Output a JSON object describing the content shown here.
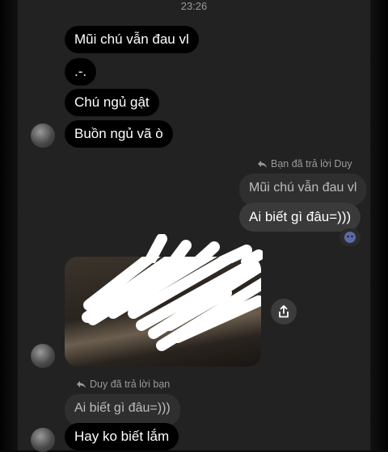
{
  "header": {
    "time": "23:26"
  },
  "messages": {
    "m1": "Mũi chú vẫn đau vl",
    "m2": ".-.",
    "m3": "Chú ngủ gật",
    "m4": "Buồn ngủ vã ò",
    "reply_note_1": "Bạn đã trả lời Duy",
    "quoted_1": "Mũi chú vẫn đau vl",
    "out_1": "Ai biết gì đâu=)))",
    "reply_note_2": "Duy đã trả lời bạn",
    "quoted_2": "Ai biết gì đâu=)))",
    "m5": "Hay ko biết lắm"
  },
  "icons": {
    "reply": "reply-arrow-icon",
    "share": "share-icon",
    "reaction": "emoji-reaction-icon"
  },
  "colors": {
    "background": "#222222",
    "incoming_bubble": "#000000",
    "outgoing_bubble": "#3a3a3a",
    "quoted_bubble": "#2f2f2f",
    "secondary_text": "#9a9a9a"
  }
}
